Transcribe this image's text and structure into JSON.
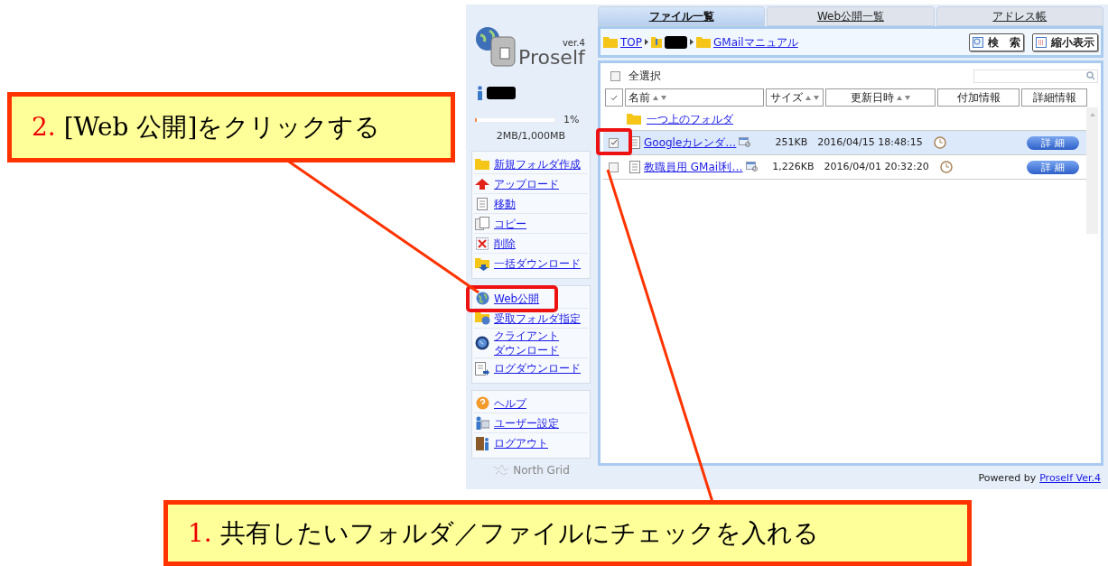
{
  "tabs": [
    {
      "label": "ファイル一覧",
      "selected": true
    },
    {
      "label": "Web公開一覧",
      "selected": false
    },
    {
      "label": "アドレス帳",
      "selected": false
    }
  ],
  "sidebar": {
    "logo": {
      "version": "ver.4",
      "name": "Proself"
    },
    "usage": {
      "percent": "1%",
      "text": "2MB/1,000MB",
      "level": 0.01
    },
    "menu_groups": [
      [
        {
          "label": "新規フォルダ作成"
        },
        {
          "label": "アップロード"
        },
        {
          "label": "移動"
        },
        {
          "label": "コピー"
        },
        {
          "label": "削除"
        },
        {
          "label": "一括ダウンロード"
        }
      ],
      [
        {
          "label": "Web公開",
          "highlighted": true
        },
        {
          "label": "受取フォルダ指定",
          "highlighted": false
        },
        {
          "lines": [
            "クライアント",
            "ダウンロード"
          ],
          "highlighted": false
        },
        {
          "label": "ログダウンロード",
          "highlighted": false
        }
      ],
      [
        {
          "label": "ヘルプ"
        },
        {
          "label": "ユーザー設定"
        },
        {
          "label": "ログアウト"
        }
      ]
    ],
    "brand": "North Grid"
  },
  "breadcrumb": [
    {
      "label": "TOP",
      "kind": "link"
    },
    {
      "kind": "redacted"
    },
    {
      "label": "GMailマニュアル",
      "kind": "link"
    }
  ],
  "toolbar_buttons": [
    "検　索",
    "縮小表示"
  ],
  "select_all": {
    "label": "全選択",
    "checked": false
  },
  "columns": [
    {
      "label": "名前",
      "sortable": true
    },
    {
      "label": "サイズ",
      "sortable": true
    },
    {
      "label": "更新日時",
      "sortable": true
    },
    {
      "label": "付加情報",
      "sortable": false
    },
    {
      "label": "詳細情報",
      "sortable": false
    }
  ],
  "parent_folder": "一つ上のフォルダ",
  "rows": [
    {
      "name": "Googleカレンダ…",
      "size": "251KB",
      "modified": "2016/04/15 18:48:15",
      "detail": "詳 細",
      "checked": true
    },
    {
      "name": "教職員用 GMail利…",
      "size": "1,226KB",
      "modified": "2016/04/01 20:32:20",
      "detail": "詳 細",
      "checked": false
    }
  ],
  "footer": {
    "text": "Powered by",
    "link": "Proself Ver.4"
  },
  "annotations": [
    {
      "number": "2.",
      "text": "[Web 公開]をクリックする"
    },
    {
      "number": "1.",
      "text": "共有したいフォルダ／ファイルにチェックを入れる"
    }
  ]
}
